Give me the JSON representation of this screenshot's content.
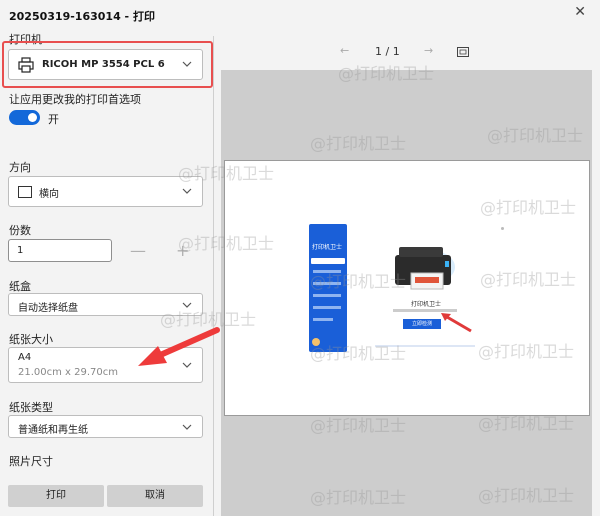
{
  "window": {
    "title": "20250319-163014 - 打印",
    "close_label": "✕"
  },
  "printer": {
    "label": "打印机",
    "value": "RICOH MP 3554 PCL 6"
  },
  "pref": {
    "label": "让应用更改我的打印首选项",
    "toggle_state": "开"
  },
  "orientation": {
    "label": "方向",
    "value": "横向"
  },
  "copies": {
    "label": "份数",
    "value": "1",
    "minus": "—",
    "plus": "+"
  },
  "tray": {
    "label": "纸盒",
    "value": "自动选择纸盘"
  },
  "paper_size": {
    "label": "纸张大小",
    "value": "A4",
    "dims": "21.00cm x 29.70cm"
  },
  "paper_type": {
    "label": "纸张类型",
    "value": "普通纸和再生纸"
  },
  "photo": {
    "label": "照片尺寸"
  },
  "actions": {
    "print": "打印",
    "cancel": "取消"
  },
  "preview": {
    "page_indicator": "1 / 1"
  },
  "thumbnail": {
    "app_title": "打印机卫士",
    "main_title": "打印机卫士",
    "button": "立即检测",
    "accent": "#1a5fd8"
  },
  "watermark": "@打印机卫士",
  "colors": {
    "accent": "#1368d9",
    "highlight": "#e84f4f"
  }
}
